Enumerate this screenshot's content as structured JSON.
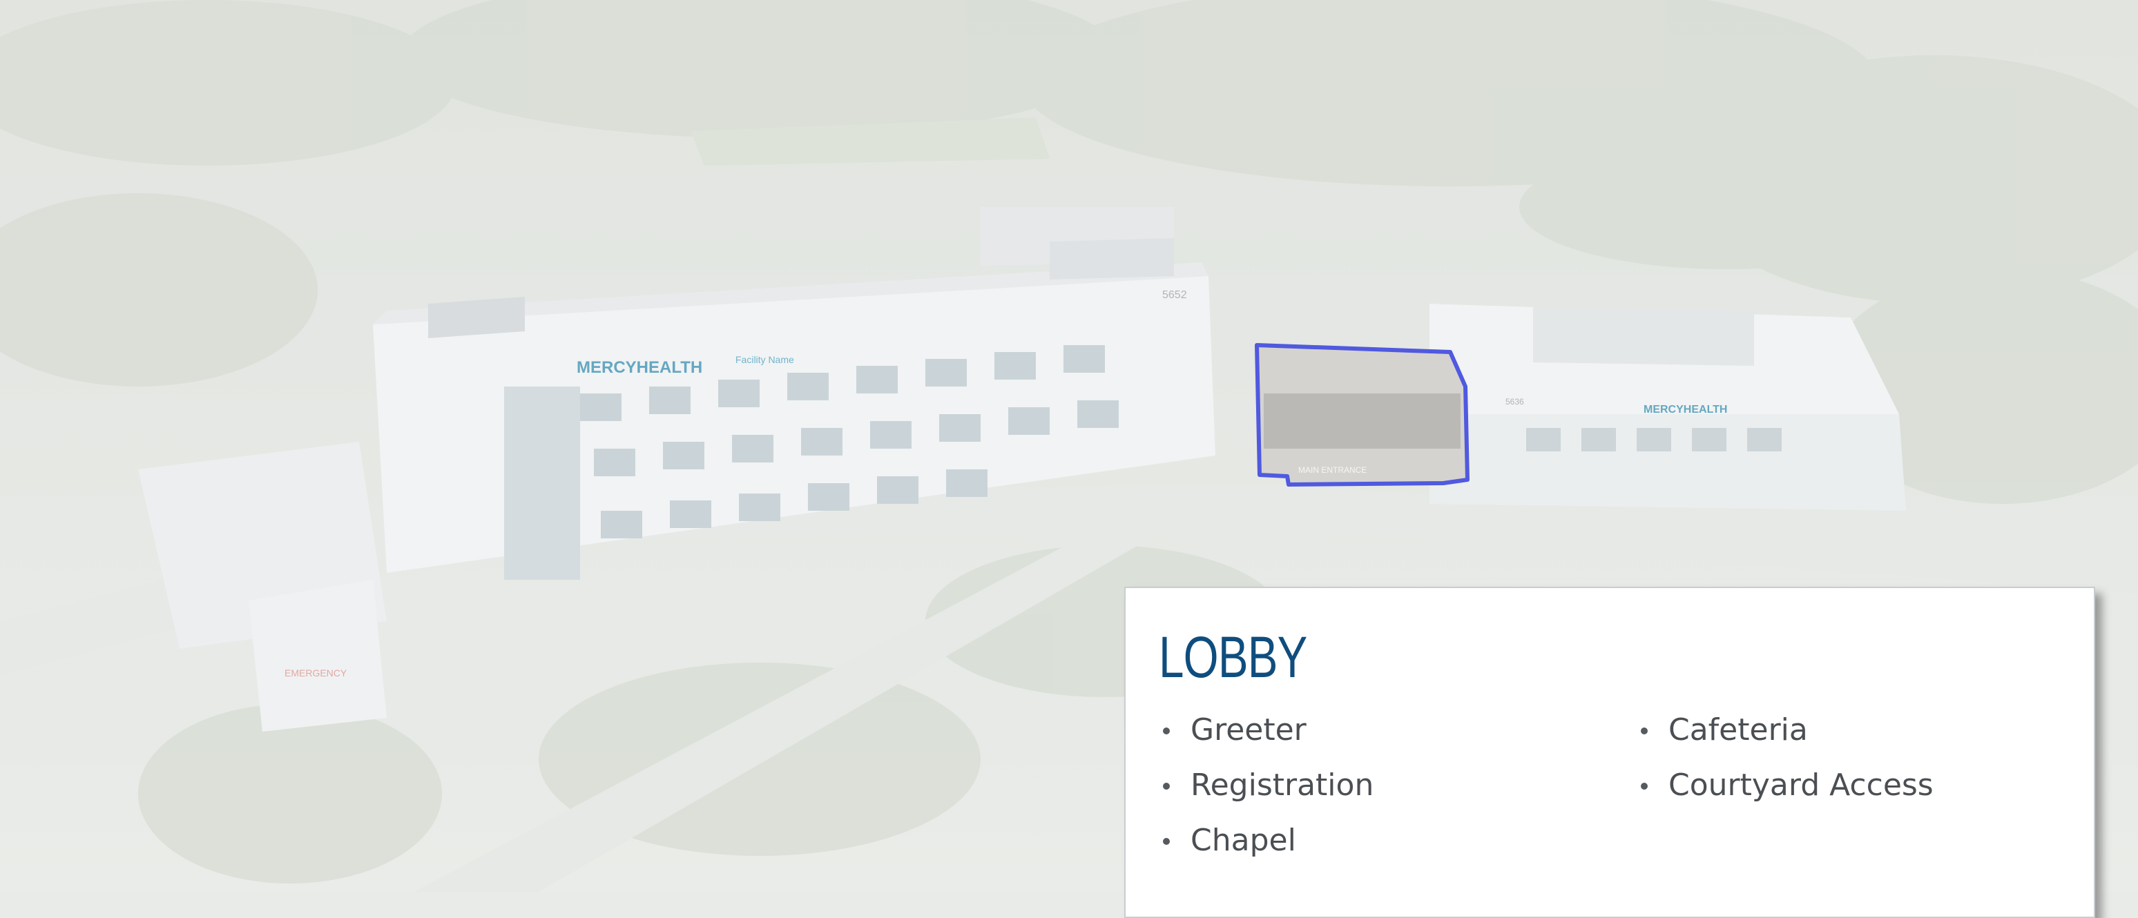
{
  "scene": {
    "building_signage": "MERCYHEALTH",
    "building_signage_sub": "Facility Name",
    "address_number_main": "5652",
    "address_number_annex": "5636",
    "emergency_sign": "EMERGENCY",
    "entrance_sign": "MAIN ENTRANCE",
    "highlight_color": "#1f2bd6"
  },
  "card": {
    "title": "LOBBY",
    "items_left": [
      "Greeter",
      "Registration",
      "Chapel"
    ],
    "items_right": [
      "Cafeteria",
      "Courtyard Access"
    ]
  },
  "colors": {
    "title": "#0f4d7e",
    "text": "#4b4f53",
    "brand_teal": "#2a9d8f"
  }
}
